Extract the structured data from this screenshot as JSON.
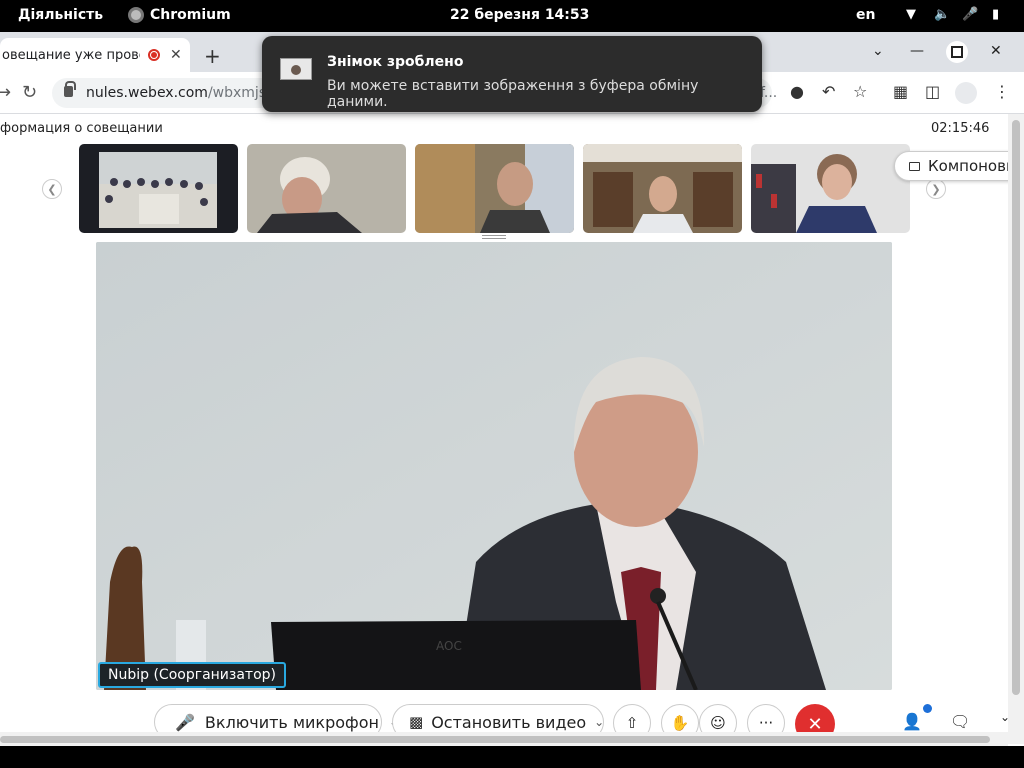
{
  "topbar": {
    "activities": "Діяльність",
    "app_name": "Chromium",
    "datetime": "22 березня  14:53",
    "lang": "en"
  },
  "tab": {
    "title": "овещание уже прово"
  },
  "address": {
    "host": "nules.webex.com",
    "path": "/wbxmjs/jo",
    "trail": "f..."
  },
  "notification": {
    "title": "Знімок зроблено",
    "body": "Ви можете вставити зображення з буфера обміну даними."
  },
  "meeting": {
    "info_label": "формация о совещании",
    "timer": "02:15:46",
    "layout_button": "Компоновк",
    "active_speaker": "Nubip (Соорганизатор)"
  },
  "controls": {
    "mute_label": "Включить микрофон",
    "video_label": "Остановить видео",
    "more_label": "···"
  },
  "colors": {
    "end_call": "#e02f2f",
    "label_border": "#29a9e0",
    "notification_bg": "#2c2c2c"
  }
}
